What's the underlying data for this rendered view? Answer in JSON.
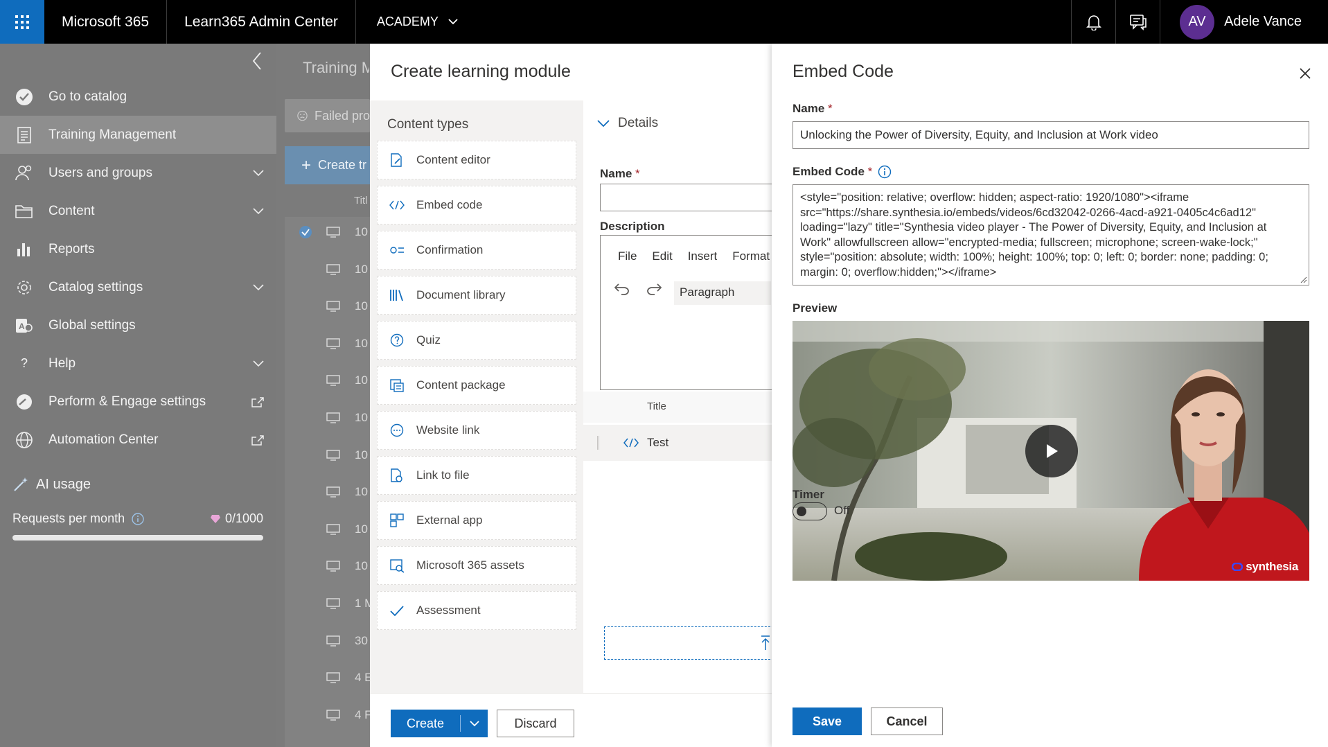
{
  "topbar": {
    "app_name": "Microsoft 365",
    "center_name": "Learn365 Admin Center",
    "tenant": "ACADEMY",
    "user_initials": "AV",
    "user_name": "Adele Vance",
    "accent": "#0f6cbd",
    "avatar_color": "#5c2e91"
  },
  "sidebar": {
    "items": [
      {
        "label": "Go to catalog",
        "icon": "check-circle-icon"
      },
      {
        "label": "Training Management",
        "icon": "document-icon",
        "active": true
      },
      {
        "label": "Users and groups",
        "icon": "people-icon",
        "expandable": true
      },
      {
        "label": "Content",
        "icon": "folder-icon",
        "expandable": true
      },
      {
        "label": "Reports",
        "icon": "bar-chart-icon"
      },
      {
        "label": "Catalog settings",
        "icon": "gear-icon",
        "expandable": true
      },
      {
        "label": "Global settings",
        "icon": "settings-app-icon"
      },
      {
        "label": "Help",
        "icon": "question-icon",
        "expandable": true
      },
      {
        "label": "Perform & Engage settings",
        "icon": "gauge-icon",
        "external": true
      },
      {
        "label": "Automation Center",
        "icon": "globe-icon",
        "external": true
      }
    ],
    "ai_usage_label": "AI usage",
    "requests_label": "Requests per month",
    "requests_count": "0/1000",
    "requests_used_fraction": 0
  },
  "background_list": {
    "title": "Training M",
    "filter_label": "Failed pro",
    "create_label": "Create tr",
    "col_title": "Titl",
    "rows": [
      "10",
      "10",
      "10",
      "10",
      "10",
      "10",
      "10",
      "10",
      "10",
      "10",
      "1 M",
      "30",
      "4 E",
      "4 F"
    ]
  },
  "create_module": {
    "title": "Create learning module",
    "content_types_heading": "Content types",
    "content_types": [
      {
        "label": "Content editor",
        "icon": "edit-document-icon"
      },
      {
        "label": "Embed code",
        "icon": "code-icon"
      },
      {
        "label": "Confirmation",
        "icon": "checklist-icon"
      },
      {
        "label": "Document library",
        "icon": "library-icon"
      },
      {
        "label": "Quiz",
        "icon": "question-circle-icon"
      },
      {
        "label": "Content package",
        "icon": "package-icon"
      },
      {
        "label": "Website link",
        "icon": "link-circle-icon"
      },
      {
        "label": "Link to file",
        "icon": "file-link-icon"
      },
      {
        "label": "External app",
        "icon": "app-grid-icon"
      },
      {
        "label": "Microsoft 365 assets",
        "icon": "m365-assets-icon"
      },
      {
        "label": "Assessment",
        "icon": "checkmark-icon"
      }
    ],
    "details_heading": "Details",
    "name_label": "Name",
    "name_value": "",
    "description_label": "Description",
    "editor_menu": [
      "File",
      "Edit",
      "Insert",
      "Format"
    ],
    "paragraph_label": "Paragraph",
    "table_col_title": "Title",
    "table_row_title": "Test",
    "create_button": "Create",
    "discard_button": "Discard"
  },
  "embed_panel": {
    "title": "Embed Code",
    "name_label": "Name",
    "name_value": "Unlocking the Power of Diversity, Equity, and Inclusion at Work video",
    "embed_label": "Embed Code",
    "embed_lines": [
      "<style=\"position: relative; overflow: hidden; aspect-ratio: 1920/1080\"><iframe",
      "src=\"https://share.synthesia.io/embeds/videos/6cd32042-0266-4acd-a921-0405c4c6ad12\"",
      "loading=\"lazy\" title=\"Synthesia video player - The Power of Diversity, Equity, and Inclusion at",
      "Work\" allowfullscreen allow=\"encrypted-media; fullscreen; microphone; screen-wake-lock;\"",
      "style=\"position: absolute; width: 100%; height: 100%; top: 0; left: 0; border: none; padding: 0;",
      "margin: 0; overflow:hidden;\"></iframe>"
    ],
    "preview_label": "Preview",
    "watermark": "synthesia",
    "timer_label": "Timer",
    "timer_state": "Off",
    "save_button": "Save",
    "cancel_button": "Cancel"
  }
}
